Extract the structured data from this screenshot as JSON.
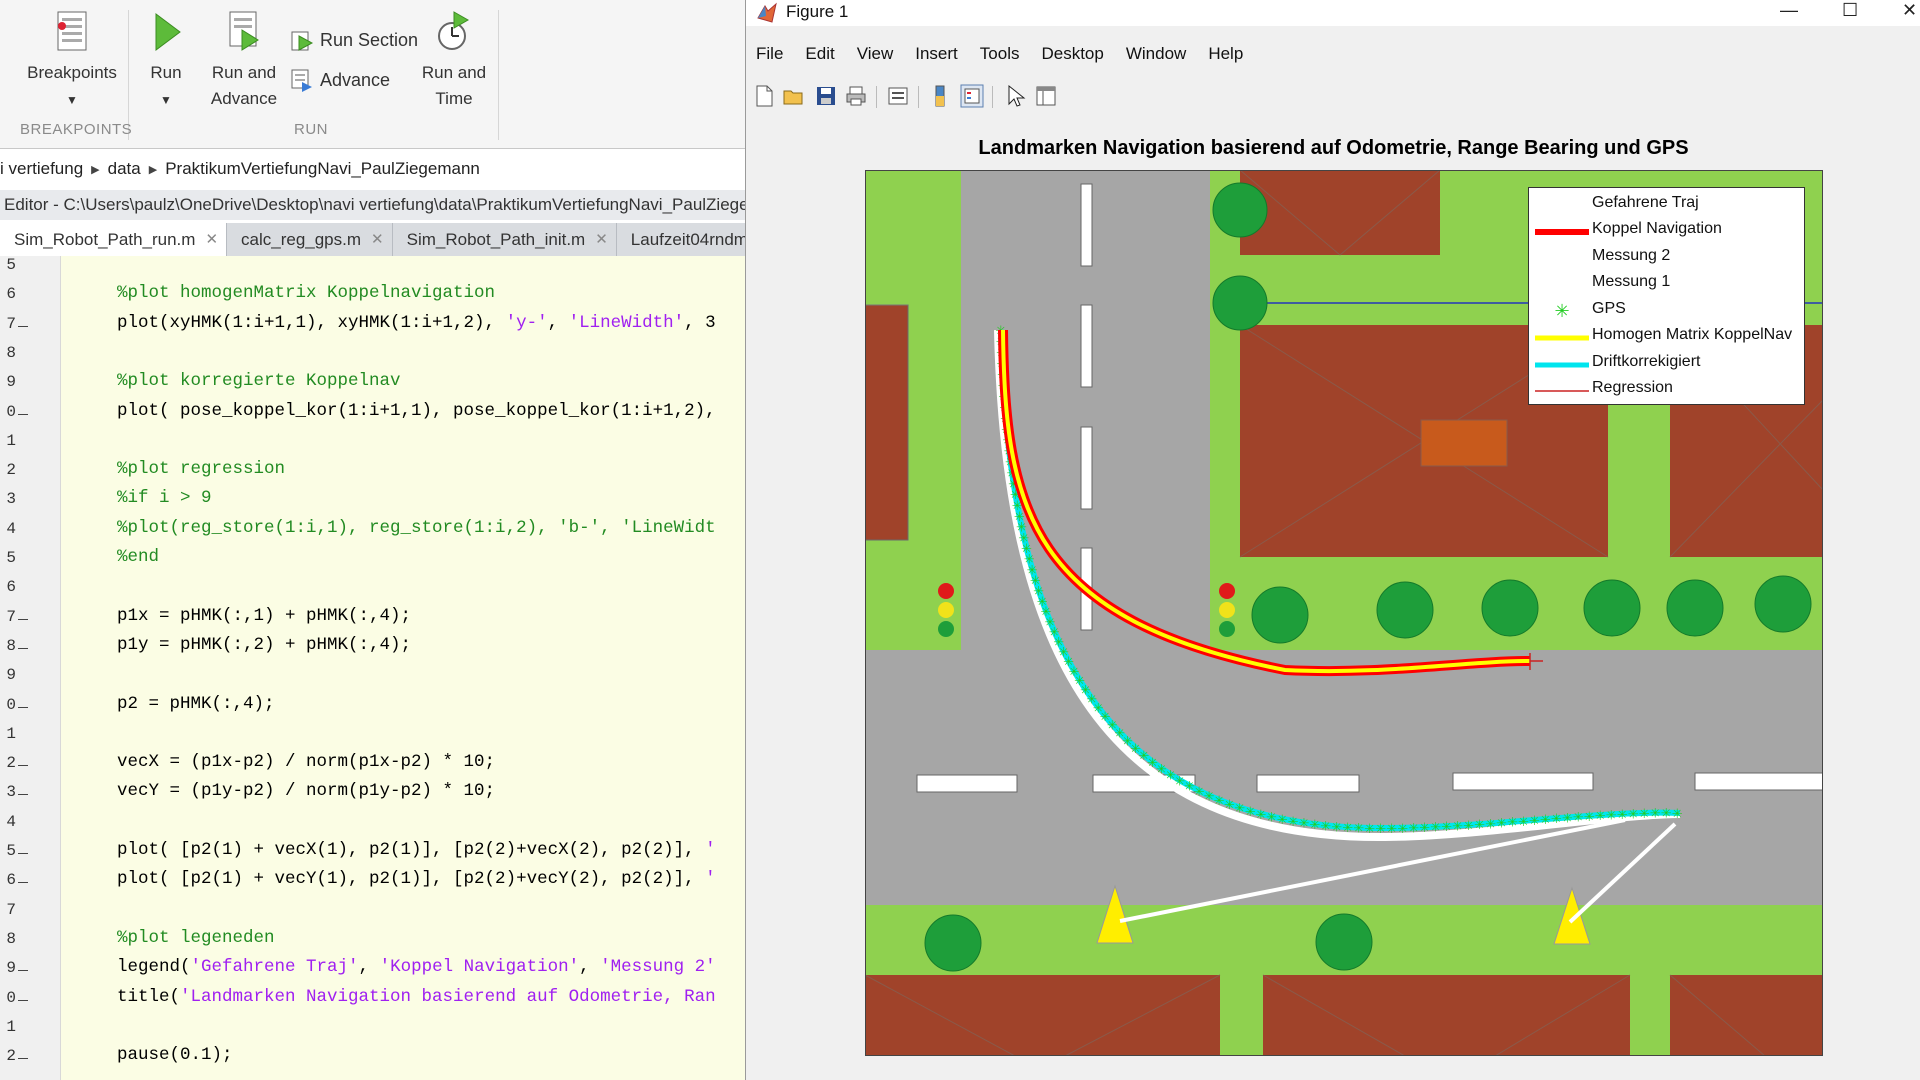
{
  "toolstrip": {
    "breakpoints": {
      "label": "Breakpoints"
    },
    "run": {
      "label": "Run"
    },
    "run_and_advance": {
      "label_line1": "Run and",
      "label_line2": "Advance"
    },
    "run_section": {
      "label": "Run Section"
    },
    "advance": {
      "label": "Advance"
    },
    "run_and_time": {
      "label_line1": "Run and",
      "label_line2": "Time"
    },
    "sections": {
      "breakpoints": "BREAKPOINTS",
      "run": "RUN"
    }
  },
  "breadcrumb": [
    "i vertiefung",
    "data",
    "PraktikumVertiefungNavi_PaulZiegemann"
  ],
  "editor_path": "Editor - C:\\Users\\paulz\\OneDrive\\Desktop\\navi vertiefung\\data\\PraktikumVertiefungNavi_PaulZiegem",
  "tabs": [
    {
      "label": "Sim_Robot_Path_run.m"
    },
    {
      "label": "calc_reg_gps.m"
    },
    {
      "label": "Sim_Robot_Path_init.m"
    },
    {
      "label": "Laufzeit04rndm"
    }
  ],
  "code": {
    "line_numbers": [
      "5",
      "6",
      "7",
      "8",
      "9",
      "0",
      "1",
      "2",
      "3",
      "4",
      "5",
      "6",
      "7",
      "8",
      "9",
      "0",
      "1",
      "2",
      "3",
      "4",
      "5",
      "6",
      "7",
      "8",
      "9",
      "0",
      "1",
      "2"
    ],
    "lines": [
      {
        "parts": []
      },
      {
        "parts": [
          {
            "t": "%plot homogenMatrix Koppelnavigation",
            "c": "cm"
          }
        ]
      },
      {
        "parts": [
          {
            "t": "plot(xyHMK(1:i+1,1), xyHMK(1:i+1,2), ",
            "c": ""
          },
          {
            "t": "'y-'",
            "c": "st"
          },
          {
            "t": ", ",
            "c": ""
          },
          {
            "t": "'LineWidth'",
            "c": "st"
          },
          {
            "t": ", 3",
            "c": ""
          }
        ]
      },
      {
        "parts": []
      },
      {
        "parts": [
          {
            "t": "%plot korregierte Koppelnav",
            "c": "cm"
          }
        ]
      },
      {
        "parts": [
          {
            "t": "plot( pose_koppel_kor(1:i+1,1), pose_koppel_kor(1:i+1,2),",
            "c": ""
          }
        ]
      },
      {
        "parts": []
      },
      {
        "parts": [
          {
            "t": "%plot regression",
            "c": "cm"
          }
        ]
      },
      {
        "parts": [
          {
            "t": "%if i > 9",
            "c": "cm"
          }
        ]
      },
      {
        "parts": [
          {
            "t": "%plot(reg_store(1:i,1), reg_store(1:i,2), 'b-', 'LineWidt",
            "c": "cm"
          }
        ]
      },
      {
        "parts": [
          {
            "t": "%end",
            "c": "cm"
          }
        ]
      },
      {
        "parts": []
      },
      {
        "parts": [
          {
            "t": "p1x = pHMK(:,1) + pHMK(:,4);",
            "c": ""
          }
        ]
      },
      {
        "parts": [
          {
            "t": "p1y = pHMK(:,2) + pHMK(:,4);",
            "c": ""
          }
        ]
      },
      {
        "parts": []
      },
      {
        "parts": [
          {
            "t": "p2 = pHMK(:,4);",
            "c": ""
          }
        ]
      },
      {
        "parts": []
      },
      {
        "parts": [
          {
            "t": "vecX = (p1x-p2) / norm(p1x-p2) * 10;",
            "c": ""
          }
        ]
      },
      {
        "parts": [
          {
            "t": "vecY = (p1y-p2) / norm(p1y-p2) * 10;",
            "c": ""
          }
        ]
      },
      {
        "parts": []
      },
      {
        "parts": [
          {
            "t": "plot( [p2(1) + vecX(1), p2(1)], [p2(2)+vecX(2), p2(2)], ",
            "c": ""
          },
          {
            "t": "'",
            "c": "st"
          }
        ]
      },
      {
        "parts": [
          {
            "t": "plot( [p2(1) + vecY(1), p2(1)], [p2(2)+vecY(2), p2(2)], ",
            "c": ""
          },
          {
            "t": "'",
            "c": "st"
          }
        ]
      },
      {
        "parts": []
      },
      {
        "parts": [
          {
            "t": "%plot legeneden",
            "c": "cm"
          }
        ]
      },
      {
        "parts": [
          {
            "t": "legend(",
            "c": ""
          },
          {
            "t": "'Gefahrene Traj'",
            "c": "st"
          },
          {
            "t": ", ",
            "c": ""
          },
          {
            "t": "'Koppel Navigation'",
            "c": "st"
          },
          {
            "t": ", ",
            "c": ""
          },
          {
            "t": "'Messung 2'",
            "c": "st"
          }
        ]
      },
      {
        "parts": [
          {
            "t": "title(",
            "c": ""
          },
          {
            "t": "'Landmarken Navigation basierend auf Odometrie, Ran",
            "c": "st"
          }
        ]
      },
      {
        "parts": []
      },
      {
        "parts": [
          {
            "t": "pause(0.1);",
            "c": ""
          }
        ]
      }
    ],
    "dash_lines": [
      2,
      5,
      12,
      13,
      15,
      17,
      18,
      20,
      21,
      24,
      25,
      27
    ]
  },
  "figure": {
    "window_title": "Figure 1",
    "menu": [
      "File",
      "Edit",
      "View",
      "Insert",
      "Tools",
      "Desktop",
      "Window",
      "Help"
    ],
    "axes_title": "Landmarken Navigation basierend auf Odometrie, Range Bearing und GPS",
    "legend": [
      {
        "label": "Gefahrene Traj",
        "color": "#ffffff",
        "style": "line"
      },
      {
        "label": "Koppel Navigation",
        "color": "#ff0000",
        "style": "thick"
      },
      {
        "label": "Messung 2",
        "color": "#ffffff",
        "style": "line"
      },
      {
        "label": "Messung 1",
        "color": "#ffffff",
        "style": "line"
      },
      {
        "label": "GPS",
        "color": "#22cc22",
        "style": "star"
      },
      {
        "label": "Homogen Matrix KoppelNav",
        "color": "#ffff00",
        "style": "thick"
      },
      {
        "label": "Driftkorrekigiert",
        "color": "#00e5ee",
        "style": "thick"
      },
      {
        "label": "Regression",
        "color": "#cc2222",
        "style": "thin"
      }
    ],
    "colors": {
      "grass": "#8fd14f",
      "road": "#a6a6a6",
      "roof": "#a0432a",
      "tree": "#1e9e3a",
      "cone": "#ffee00",
      "trajectory_white": "#ffffff",
      "koppel_red": "#ff0000",
      "hmk_yellow": "#ffff00",
      "drift_cyan": "#00e5ee",
      "gps_green": "#22cc22"
    }
  }
}
